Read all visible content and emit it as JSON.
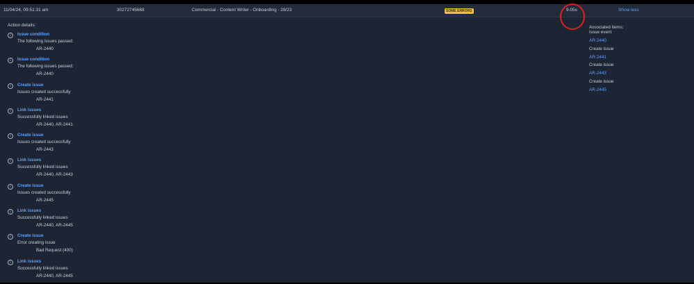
{
  "header": {
    "timestamp": "11/04/24, 09:51:31 am",
    "rule_id": "30272745668",
    "rule_name": "Commercial - Content Writer - Onboarding - 28/23",
    "status_badge": "SOME ERRORS",
    "duration": "9.05s",
    "toggle_label": "Show less"
  },
  "section_title": "Action details:",
  "actions": [
    {
      "icon": "info-icon",
      "title": "Issue condition",
      "message": "The following issues passed:",
      "detail": "AR-2440"
    },
    {
      "icon": "info-icon",
      "title": "Issue condition",
      "message": "The following issues passed:",
      "detail": "AR-2440"
    },
    {
      "icon": "info-icon",
      "title": "Create issue",
      "message": "Issues created successfully",
      "detail": "AR-2441"
    },
    {
      "icon": "info-icon",
      "title": "Link issues",
      "message": "Successfully linked issues",
      "detail": "AR-2440, AR-2441"
    },
    {
      "icon": "info-icon",
      "title": "Create issue",
      "message": "Issues created successfully",
      "detail": "AR-2443"
    },
    {
      "icon": "info-icon",
      "title": "Link issues",
      "message": "Successfully linked issues",
      "detail": "AR-2440, AR-2443"
    },
    {
      "icon": "info-icon",
      "title": "Create issue",
      "message": "Issues created successfully",
      "detail": "AR-2445"
    },
    {
      "icon": "info-icon",
      "title": "Link issues",
      "message": "Successfully linked issues",
      "detail": "AR-2440, AR-2445"
    },
    {
      "icon": "info-icon",
      "title": "Create issue",
      "message": "Error creating issue",
      "detail": "Bad Request (400)"
    },
    {
      "icon": "info-icon",
      "title": "Link issues",
      "message": "Successfully linked issues",
      "detail": "AR-2440, AR-2445"
    }
  ],
  "associated": {
    "title": "Associated items:",
    "items": [
      {
        "label": "Issue event",
        "link": "AR-2440"
      },
      {
        "label": "Create issue",
        "link": "AR-2441"
      },
      {
        "label": "Create issue",
        "link": "AR-2443"
      },
      {
        "label": "Create issue",
        "link": "AR-2445"
      }
    ]
  },
  "colors": {
    "background": "#1d2433",
    "link": "#5ea3ff",
    "badge": "#e8c03a",
    "annotation_circle": "#e0201c"
  }
}
